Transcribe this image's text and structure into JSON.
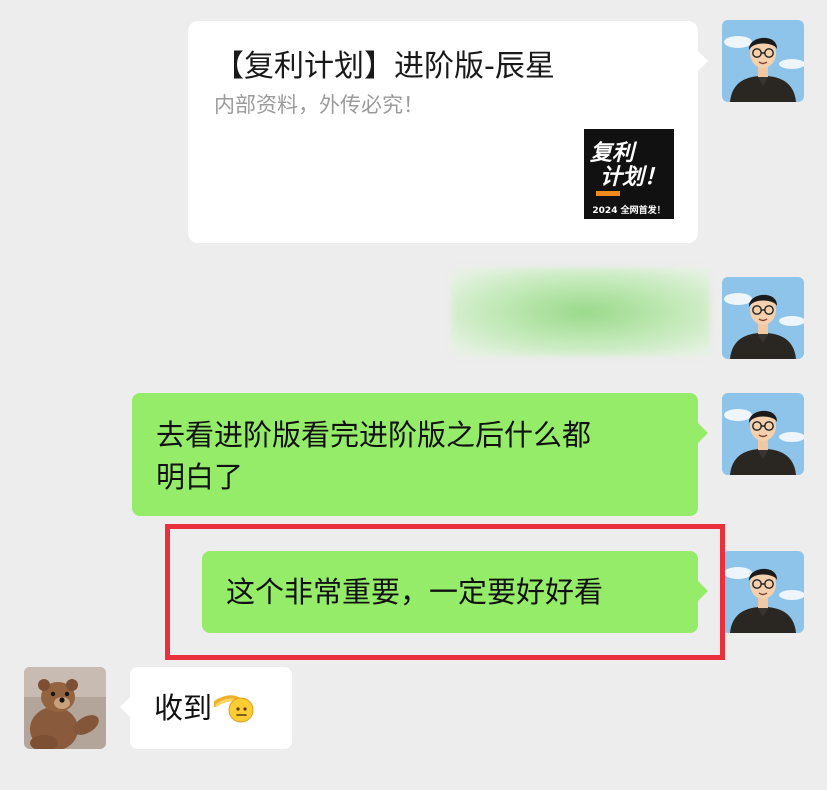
{
  "link_card": {
    "title": "【复利计划】进阶版-辰星",
    "description": "内部资料，外传必究！",
    "thumbnail": {
      "line1": "复利",
      "line2": "计划！",
      "caption": "2024 全网首发！"
    }
  },
  "messages": [
    {
      "sender": "self",
      "text": "去看进阶版看完进阶版之后什么都",
      "text2": "明白了"
    },
    {
      "sender": "self",
      "text": "这个非常重要，一定要好好看",
      "highlighted": true
    },
    {
      "sender": "other",
      "text": "收到",
      "emoji": "pointing-hand-emoji"
    }
  ],
  "colors": {
    "background": "#ededed",
    "self_bubble": "#95ec69",
    "other_bubble": "#ffffff",
    "highlight_border": "#e8313b"
  }
}
